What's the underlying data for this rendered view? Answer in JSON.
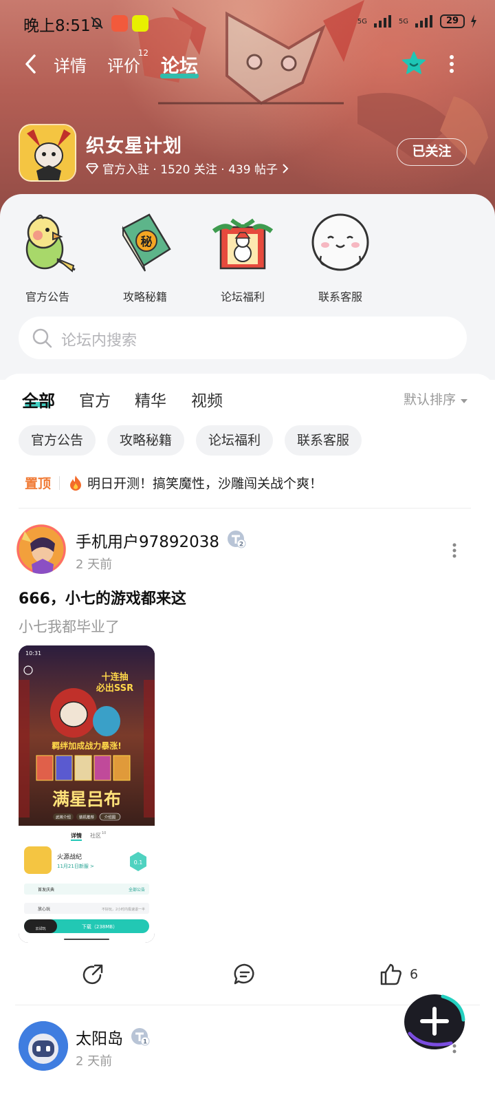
{
  "status_bar": {
    "time": "晚上8:51",
    "battery": "29",
    "signal_1": "5G",
    "signal_2": "5G"
  },
  "nav": {
    "tabs": [
      {
        "label": "详情"
      },
      {
        "label": "评价",
        "count": "12"
      },
      {
        "label": "论坛"
      }
    ]
  },
  "game": {
    "title": "织女星计划",
    "meta": "官方入驻 · 1520 关注 · 439 帖子",
    "follow_label": "已关注"
  },
  "shortcuts": [
    {
      "label": "官方公告",
      "icon": "parrot-icon"
    },
    {
      "label": "攻略秘籍",
      "icon": "secret-book-icon"
    },
    {
      "label": "论坛福利",
      "icon": "gift-box-icon"
    },
    {
      "label": "联系客服",
      "icon": "customer-service-icon"
    }
  ],
  "search": {
    "placeholder": "论坛内搜索"
  },
  "category_tabs": [
    "全部",
    "官方",
    "精华",
    "视频"
  ],
  "sort": {
    "label": "默认排序"
  },
  "chips": [
    "官方公告",
    "攻略秘籍",
    "论坛福利",
    "联系客服"
  ],
  "pinned": {
    "label": "置顶",
    "text": "明日开测！搞笑魔性，沙雕闯关战个爽！"
  },
  "posts": [
    {
      "author": "手机用户97892038",
      "level": "2",
      "time": "2 天前",
      "title": "666，小七的游戏都来这",
      "body": "小七我都毕业了",
      "likes": "6",
      "image": {
        "status_time": "10:31",
        "banner_line1": "十连抽",
        "banner_line2": "必出SSR",
        "tagline": "羁绊加成战力暴涨!",
        "big_text": "满星吕布",
        "buttons": [
          "武将介绍",
          "装机推荐",
          "介绍图"
        ],
        "tabs": [
          "详情",
          "社区"
        ],
        "tab_count": "10",
        "game_name": "火源战纪",
        "release": "11月21日新服 >",
        "score": "0.1",
        "row1_left": "首发庆典",
        "row1_right": "全部公告",
        "row2_left": "放心玩",
        "row2_right": "不好玩，2小时内极速退一半",
        "trial_label": "云试玩",
        "download": "下载（238MB）"
      }
    },
    {
      "author": "太阳岛",
      "level": "1",
      "time": "2 天前"
    }
  ],
  "colors": {
    "accent": "#20c6b6",
    "pin": "#f07a35"
  }
}
